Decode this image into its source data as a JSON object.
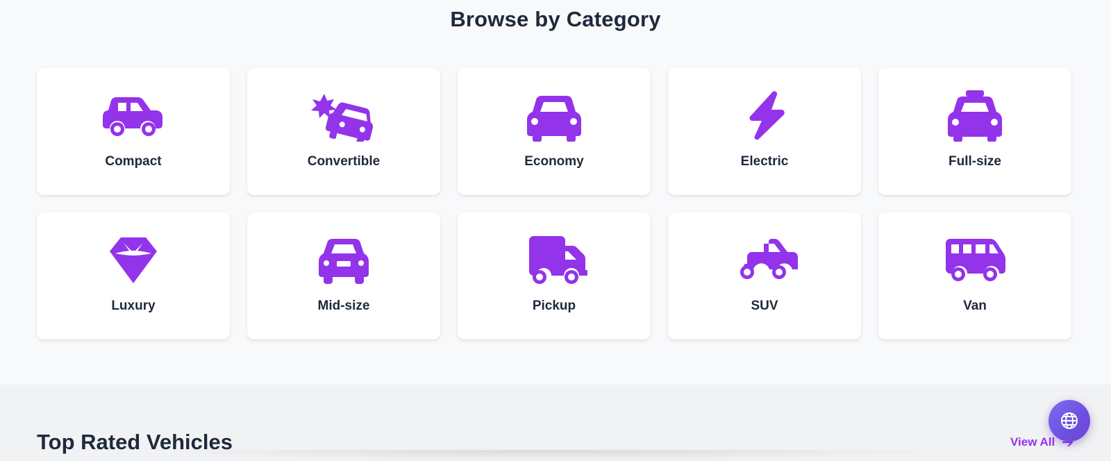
{
  "browse": {
    "title": "Browse by Category",
    "categories": [
      {
        "label": "Compact",
        "icon": "car-side-icon"
      },
      {
        "label": "Convertible",
        "icon": "car-crash-icon"
      },
      {
        "label": "Economy",
        "icon": "car-icon"
      },
      {
        "label": "Electric",
        "icon": "bolt-icon"
      },
      {
        "label": "Full-size",
        "icon": "taxi-icon"
      },
      {
        "label": "Luxury",
        "icon": "gem-icon"
      },
      {
        "label": "Mid-size",
        "icon": "car-front-icon"
      },
      {
        "label": "Pickup",
        "icon": "truck-icon"
      },
      {
        "label": "SUV",
        "icon": "truck-pickup-icon"
      },
      {
        "label": "Van",
        "icon": "van-shuttle-icon"
      }
    ]
  },
  "top_rated": {
    "title": "Top Rated Vehicles",
    "view_all_label": "View All"
  },
  "fab": {
    "icon": "globe-icon"
  },
  "colors": {
    "accent": "#9333ea",
    "heading": "#1e293b",
    "fab": "#6c4fe0"
  }
}
